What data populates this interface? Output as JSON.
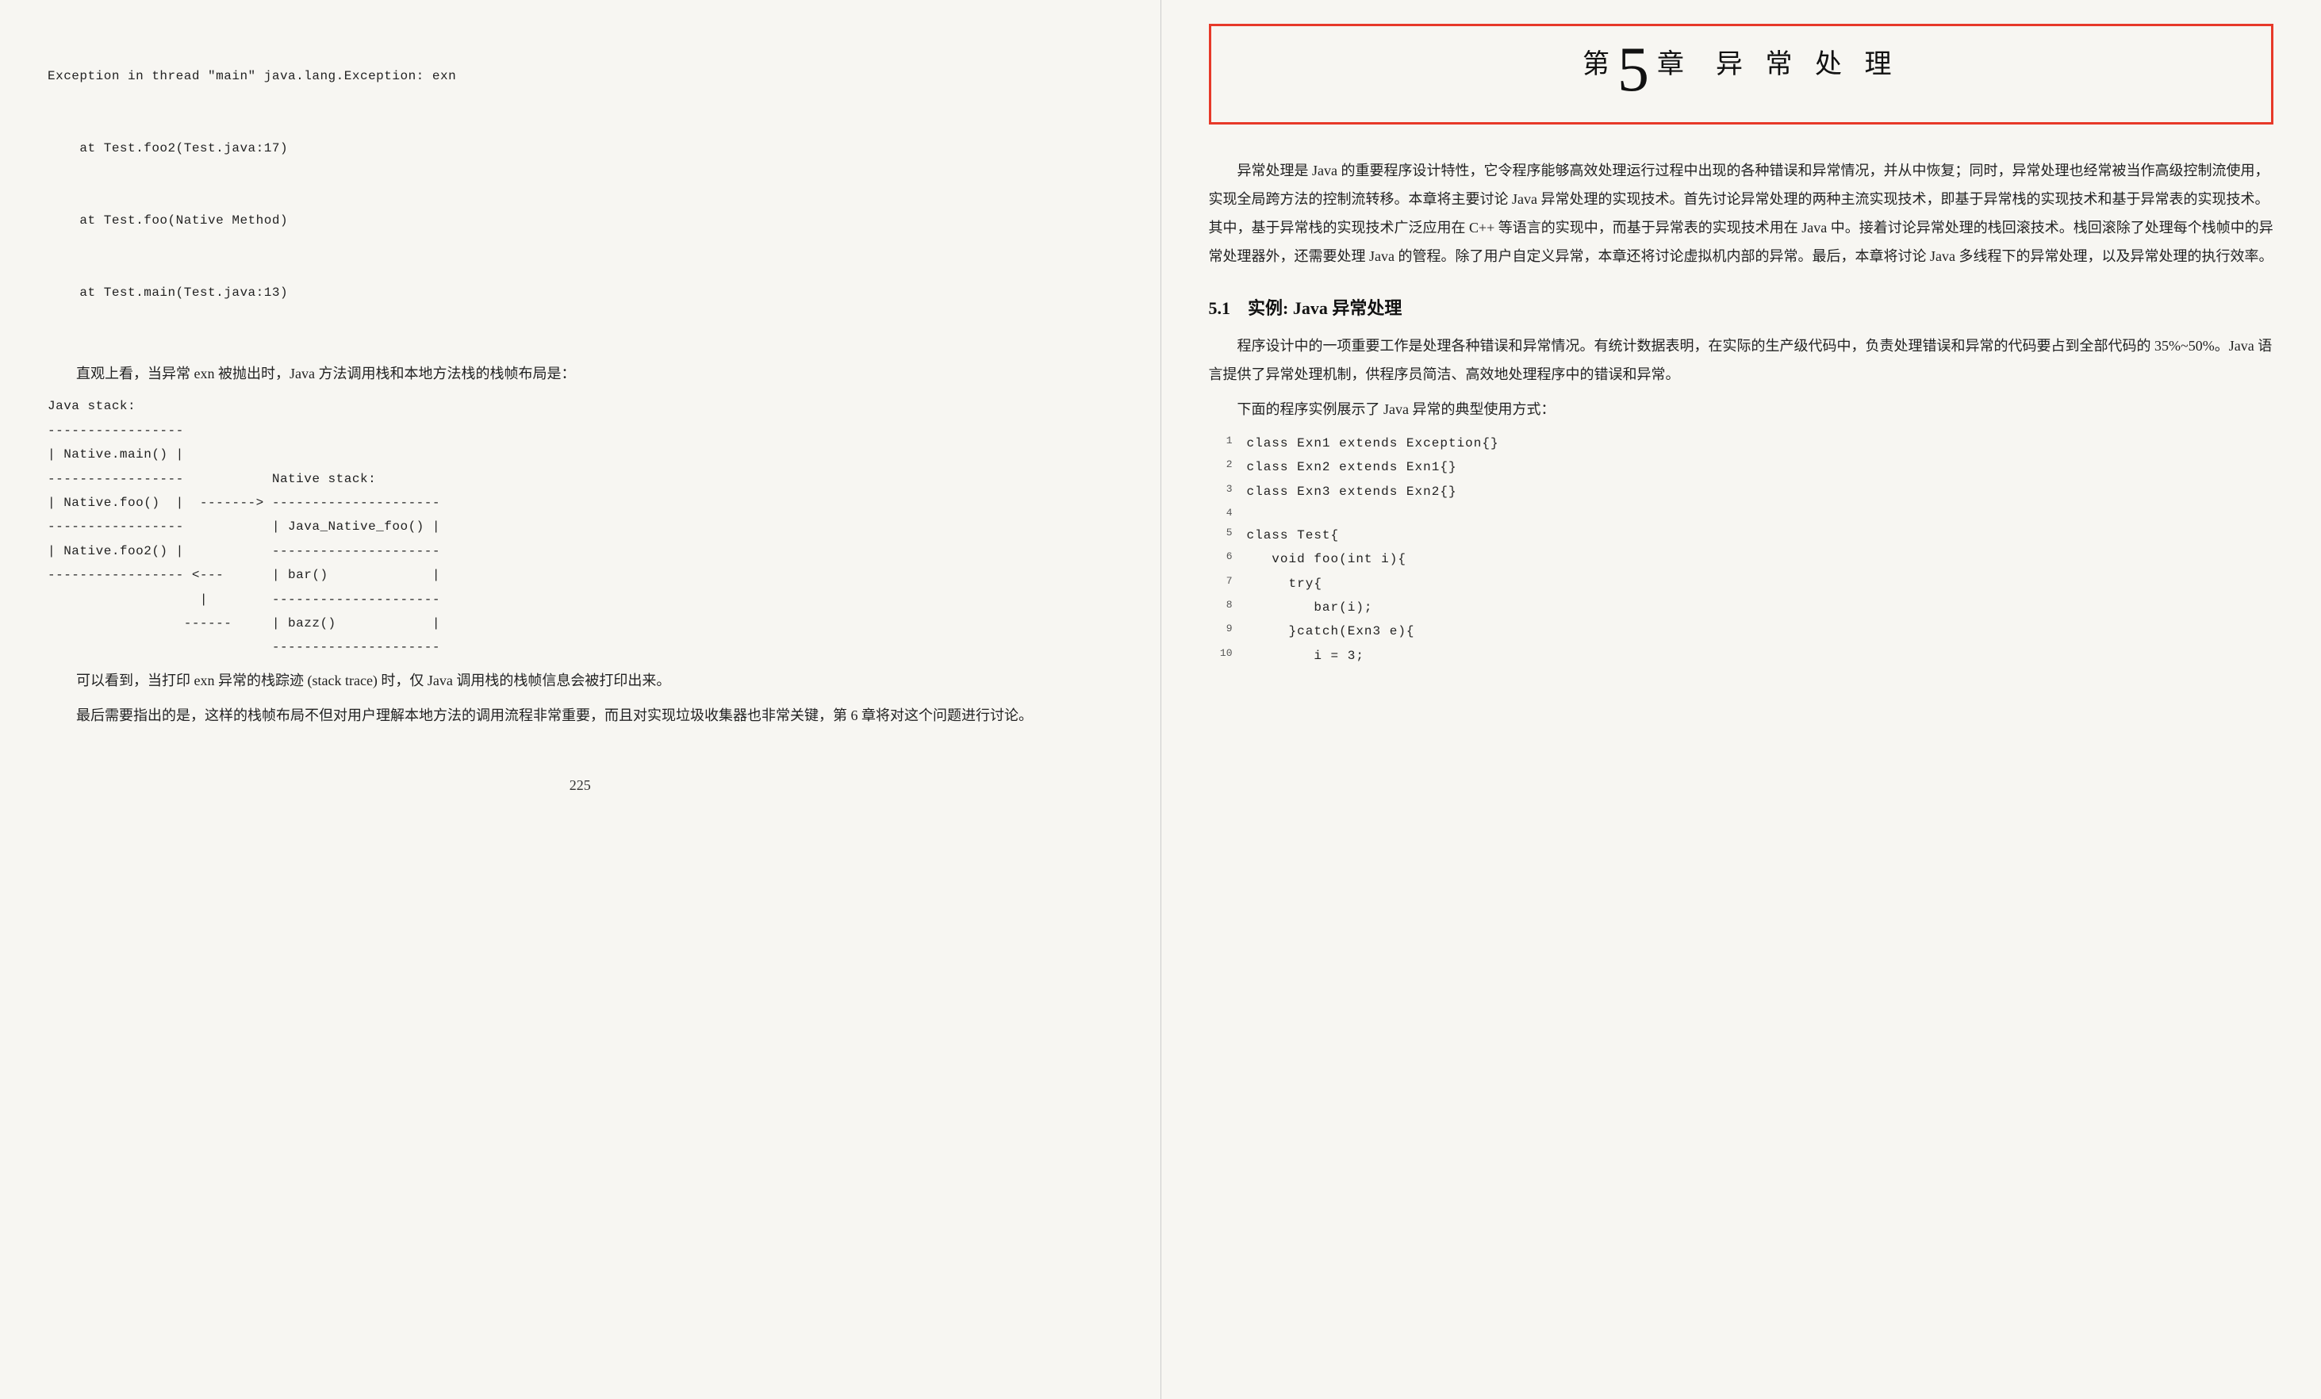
{
  "left": {
    "trace": [
      "Exception in thread \"main\" java.lang.Exception: exn",
      "    at Test.foo2(Test.java:17)",
      "    at Test.foo(Native Method)",
      "    at Test.main(Test.java:13)"
    ],
    "p1": "直观上看，当异常 exn 被抛出时，Java 方法调用栈和本地方法栈的栈帧布局是：",
    "stack_diagram": "Java stack:\n-----------------\n| Native.main() |\n-----------------           Native stack:\n| Native.foo()  |  -------> ---------------------\n-----------------           | Java_Native_foo() |\n| Native.foo2() |           ---------------------\n----------------- <---      | bar()             |\n                   |        ---------------------\n                 ------     | bazz()            |\n                            ---------------------",
    "p2": "可以看到，当打印 exn 异常的栈踪迹 (stack trace) 时，仅 Java 调用栈的栈帧信息会被打印出来。",
    "p3": "最后需要指出的是，这样的栈帧布局不但对用户理解本地方法的调用流程非常重要，而且对实现垃圾收集器也非常关键，第 6 章将对这个问题进行讨论。",
    "page_number": "225"
  },
  "right": {
    "chapter_prefix": "第",
    "chapter_num": "5",
    "chapter_suffix": "章",
    "chapter_title": "异 常 处 理",
    "intro": "异常处理是 Java 的重要程序设计特性，它令程序能够高效处理运行过程中出现的各种错误和异常情况，并从中恢复；同时，异常处理也经常被当作高级控制流使用，实现全局跨方法的控制流转移。本章将主要讨论 Java 异常处理的实现技术。首先讨论异常处理的两种主流实现技术，即基于异常栈的实现技术和基于异常表的实现技术。其中，基于异常栈的实现技术广泛应用在 C++ 等语言的实现中，而基于异常表的实现技术用在 Java 中。接着讨论异常处理的栈回滚技术。栈回滚除了处理每个栈帧中的异常处理器外，还需要处理 Java 的管程。除了用户自定义异常，本章还将讨论虚拟机内部的异常。最后，本章将讨论 Java 多线程下的异常处理，以及异常处理的执行效率。",
    "section_heading": "5.1　实例: Java 异常处理",
    "p1": "程序设计中的一项重要工作是处理各种错误和异常情况。有统计数据表明，在实际的生产级代码中，负责处理错误和异常的代码要占到全部代码的 35%~50%。Java 语言提供了异常处理机制，供程序员简洁、高效地处理程序中的错误和异常。",
    "p2": "下面的程序实例展示了 Java 异常的典型使用方式：",
    "code": [
      {
        "n": "1",
        "t": "class Exn1 extends Exception{}"
      },
      {
        "n": "2",
        "t": "class Exn2 extends Exn1{}"
      },
      {
        "n": "3",
        "t": "class Exn3 extends Exn2{}"
      },
      {
        "n": "4",
        "t": ""
      },
      {
        "n": "5",
        "t": "class Test{"
      },
      {
        "n": "6",
        "t": "   void foo(int i){"
      },
      {
        "n": "7",
        "t": "     try{"
      },
      {
        "n": "8",
        "t": "        bar(i);"
      },
      {
        "n": "9",
        "t": "     }catch(Exn3 e){"
      },
      {
        "n": "10",
        "t": "        i = 3;"
      }
    ]
  }
}
